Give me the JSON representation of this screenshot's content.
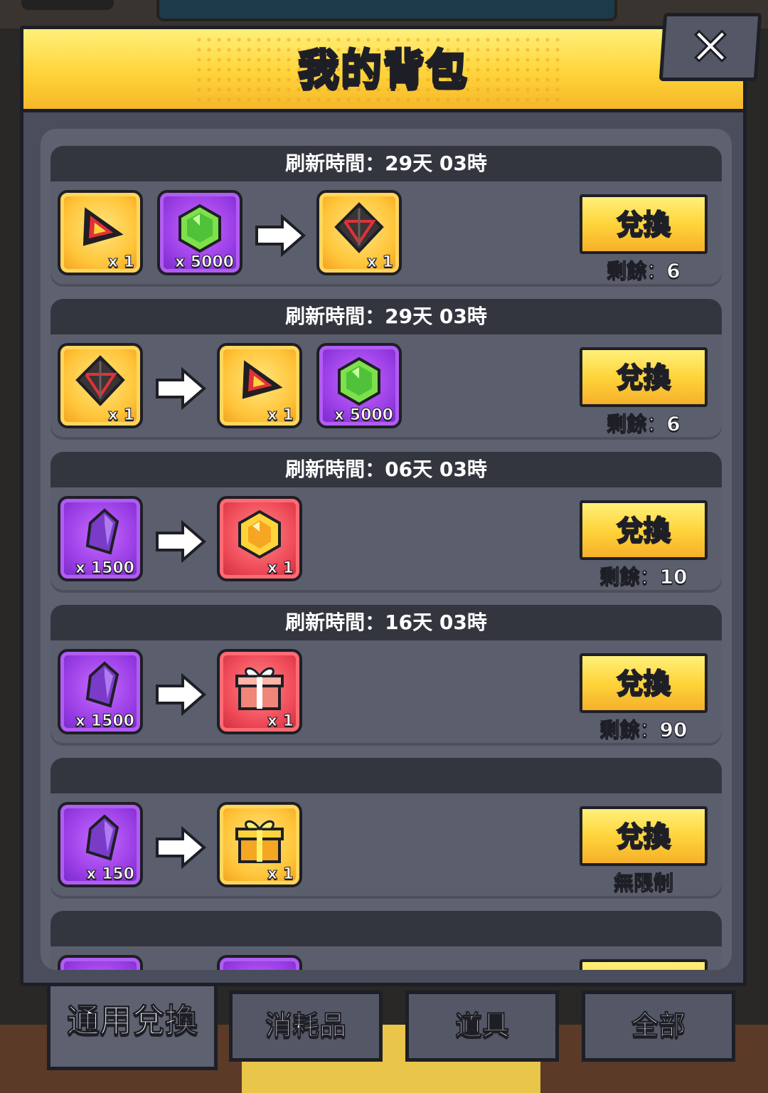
{
  "header": {
    "title": "我的背包",
    "close_label": "✕"
  },
  "exchange_label": "兌換",
  "rows": [
    {
      "refresh": "刷新時間：29天 03時",
      "left_items": [
        {
          "icon": "red-triangle-relic-icon",
          "qty": "x 1"
        },
        {
          "icon": "green-gem-icon",
          "qty": "x 5000"
        }
      ],
      "right_items": [
        {
          "icon": "dark-crystal-relic-icon",
          "qty": "x 1"
        }
      ],
      "remaining": "剩餘：6"
    },
    {
      "refresh": "刷新時間：29天 03時",
      "left_items": [
        {
          "icon": "dark-crystal-relic-icon",
          "qty": "x 1"
        }
      ],
      "right_items": [
        {
          "icon": "red-triangle-relic-icon",
          "qty": "x 1"
        },
        {
          "icon": "green-gem-icon",
          "qty": "x 5000"
        }
      ],
      "remaining": "剩餘：6"
    },
    {
      "refresh": "刷新時間：06天 03時",
      "left_items": [
        {
          "icon": "purple-crystal-icon",
          "qty": "x 1500"
        }
      ],
      "right_items": [
        {
          "icon": "gold-hexagon-gem-icon",
          "qty": "x 1"
        }
      ],
      "remaining": "剩餘：10"
    },
    {
      "refresh": "刷新時間：16天 03時",
      "left_items": [
        {
          "icon": "purple-crystal-icon",
          "qty": "x 1500"
        }
      ],
      "right_items": [
        {
          "icon": "red-gift-box-icon",
          "qty": "x 1"
        }
      ],
      "remaining": "剩餘：90"
    },
    {
      "refresh": "",
      "left_items": [
        {
          "icon": "purple-crystal-icon",
          "qty": "x 150"
        }
      ],
      "right_items": [
        {
          "icon": "gold-gift-box-icon",
          "qty": "x 1"
        }
      ],
      "remaining": "無限制"
    }
  ],
  "tabs": [
    {
      "label": "通用兌換",
      "active": true
    },
    {
      "label": "消耗品",
      "active": false
    },
    {
      "label": "道具",
      "active": false
    },
    {
      "label": "全部",
      "active": false
    }
  ],
  "colors": {
    "gold": "#ffd43a",
    "purple": "#9a3ee6",
    "red": "#ef4a58",
    "panel": "#4a4d5b",
    "outline": "#1e1f26"
  }
}
